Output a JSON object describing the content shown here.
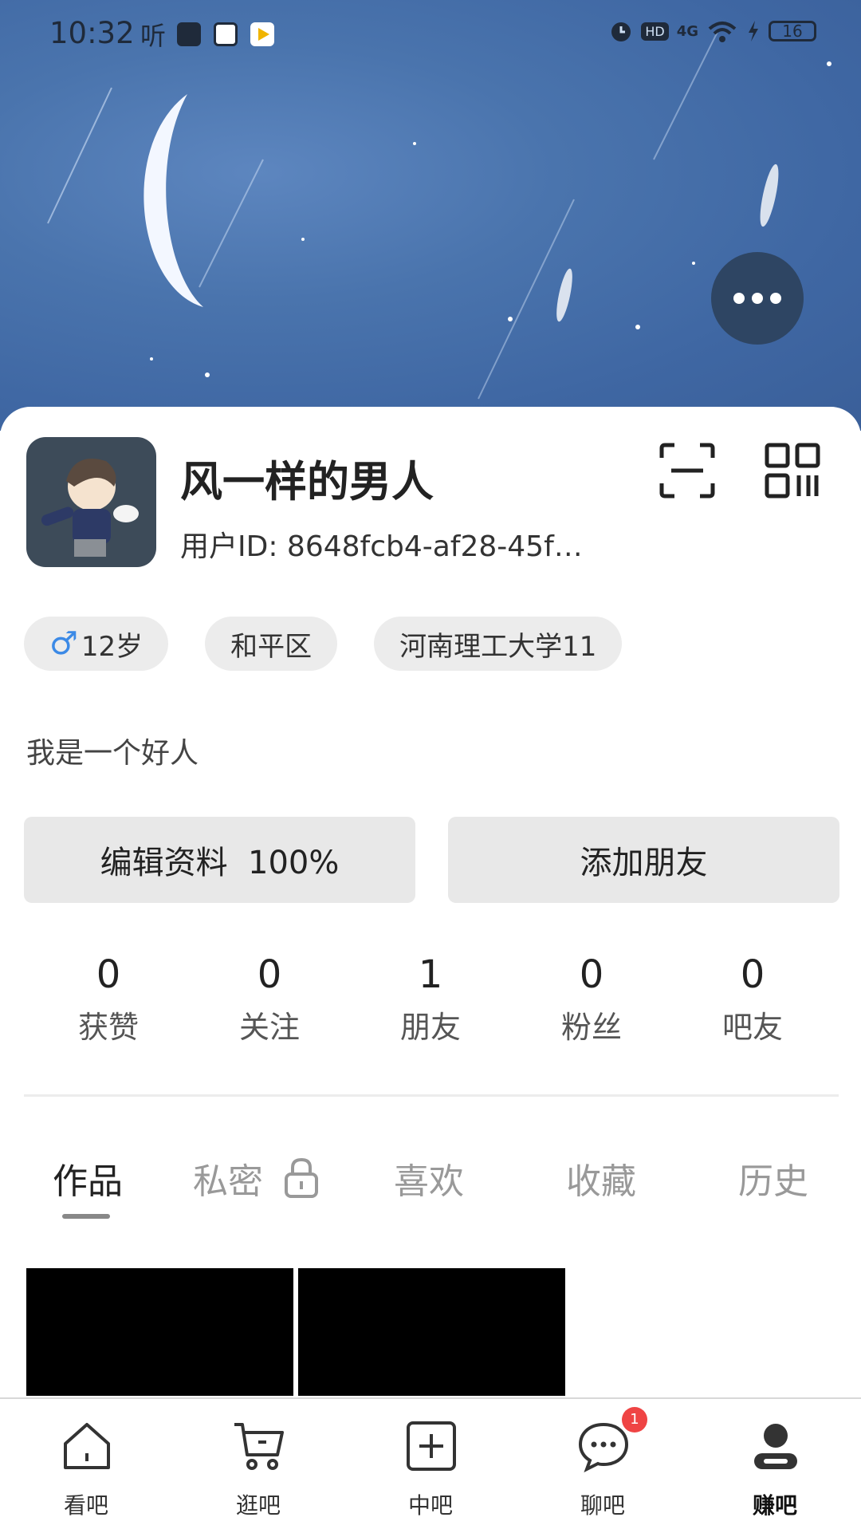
{
  "status_bar": {
    "time": "10:32",
    "listen_label": "听",
    "network": "4G",
    "hd": "HD",
    "battery": "16"
  },
  "profile": {
    "name": "风一样的男人",
    "user_id": "用户ID: 8648fcb4-af28-45f…",
    "tags": {
      "age": "12岁",
      "district": "和平区",
      "school": "河南理工大学11"
    },
    "bio": "我是一个好人"
  },
  "actions": {
    "edit_label": "编辑资料  100%",
    "add_friend_label": "添加朋友"
  },
  "stats": [
    {
      "value": "0",
      "label": "获赞"
    },
    {
      "value": "0",
      "label": "关注"
    },
    {
      "value": "1",
      "label": "朋友"
    },
    {
      "value": "0",
      "label": "粉丝"
    },
    {
      "value": "0",
      "label": "吧友"
    }
  ],
  "tabs": [
    {
      "label": "作品"
    },
    {
      "label": "私密"
    },
    {
      "label": "喜欢"
    },
    {
      "label": "收藏"
    },
    {
      "label": "历史"
    }
  ],
  "bottom_nav": [
    {
      "label": "看吧",
      "icon": "home-icon"
    },
    {
      "label": "逛吧",
      "icon": "cart-icon"
    },
    {
      "label": "中吧",
      "icon": "plus-box-icon"
    },
    {
      "label": "聊吧",
      "icon": "chat-icon",
      "badge": "1"
    },
    {
      "label": "赚吧",
      "icon": "person-icon"
    }
  ],
  "colors": {
    "banner_blue": "#4a74ad",
    "more_button": "#2e4563",
    "male_symbol": "#3c8ae6",
    "badge_red": "#ef4444"
  }
}
